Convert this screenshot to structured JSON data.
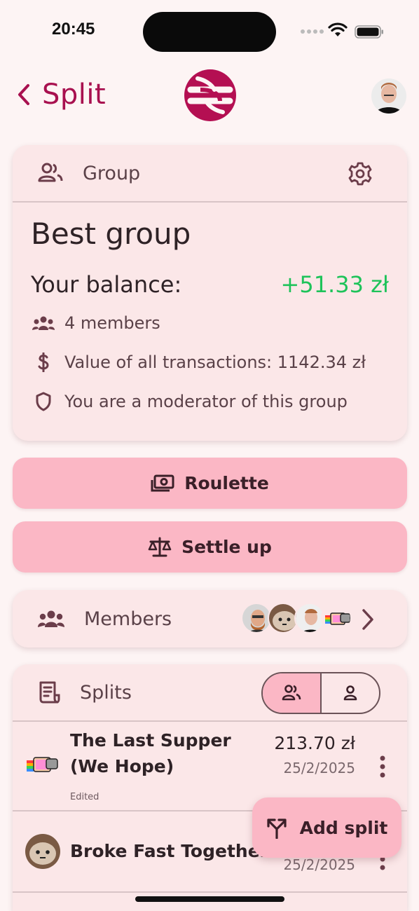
{
  "status_bar": {
    "time": "20:45"
  },
  "header": {
    "back_label": "Split"
  },
  "group_card": {
    "header_title": "Group",
    "name": "Best group",
    "balance_label": "Your balance:",
    "balance_value": "+51.33 zł",
    "members_count": "4 members",
    "transactions_value": "Value of all transactions: 1142.34 zł",
    "moderator_note": "You are a moderator of this group"
  },
  "buttons": {
    "roulette": "Roulette",
    "settle_up": "Settle up"
  },
  "members_card": {
    "title": "Members"
  },
  "splits": {
    "title": "Splits",
    "items": [
      {
        "title": "The Last Supper (We Hope)",
        "edited": "Edited",
        "amount": "213.70 zł",
        "date": "25/2/2025"
      },
      {
        "title": "Broke Fast Together",
        "date": "25/2/2025"
      }
    ]
  },
  "fab": {
    "label": "Add split"
  },
  "colors": {
    "accent": "#a8104f",
    "button": "#fbb7c5",
    "card": "#fbe7e8",
    "positive": "#1ec35a"
  }
}
